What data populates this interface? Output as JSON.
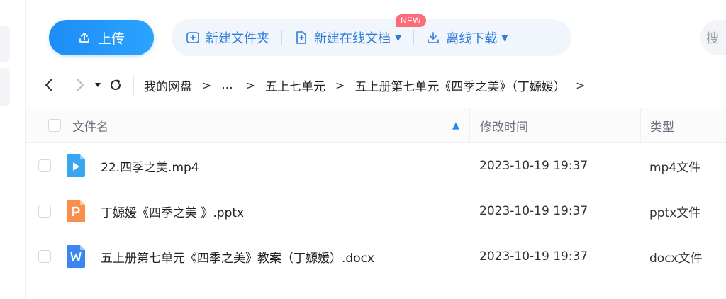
{
  "toolbar": {
    "upload_label": "上传",
    "new_folder_label": "新建文件夹",
    "new_online_doc_label": "新建在线文档",
    "new_badge": "NEW",
    "offline_download_label": "离线下载",
    "search_placeholder": "搜",
    "accent_color": "#1e8cf5"
  },
  "breadcrumb": {
    "items": [
      "我的网盘",
      "...",
      "五上七单元",
      "五上册第七单元《四季之美》（丁嫄媛）"
    ]
  },
  "table": {
    "columns": {
      "name": "文件名",
      "modified": "修改时间",
      "type": "类型"
    },
    "rows": [
      {
        "icon": "video-file-icon",
        "name": "22.四季之美.mp4",
        "modified": "2023-10-19 19:37",
        "type": "mp4文件"
      },
      {
        "icon": "pptx-file-icon",
        "name": "丁嫄媛《四季之美 》.pptx",
        "modified": "2023-10-19 19:37",
        "type": "pptx文件"
      },
      {
        "icon": "docx-file-icon",
        "name": "五上册第七单元《四季之美》教案（丁嫄媛）.docx",
        "modified": "2023-10-19 19:37",
        "type": "docx文件"
      }
    ]
  }
}
